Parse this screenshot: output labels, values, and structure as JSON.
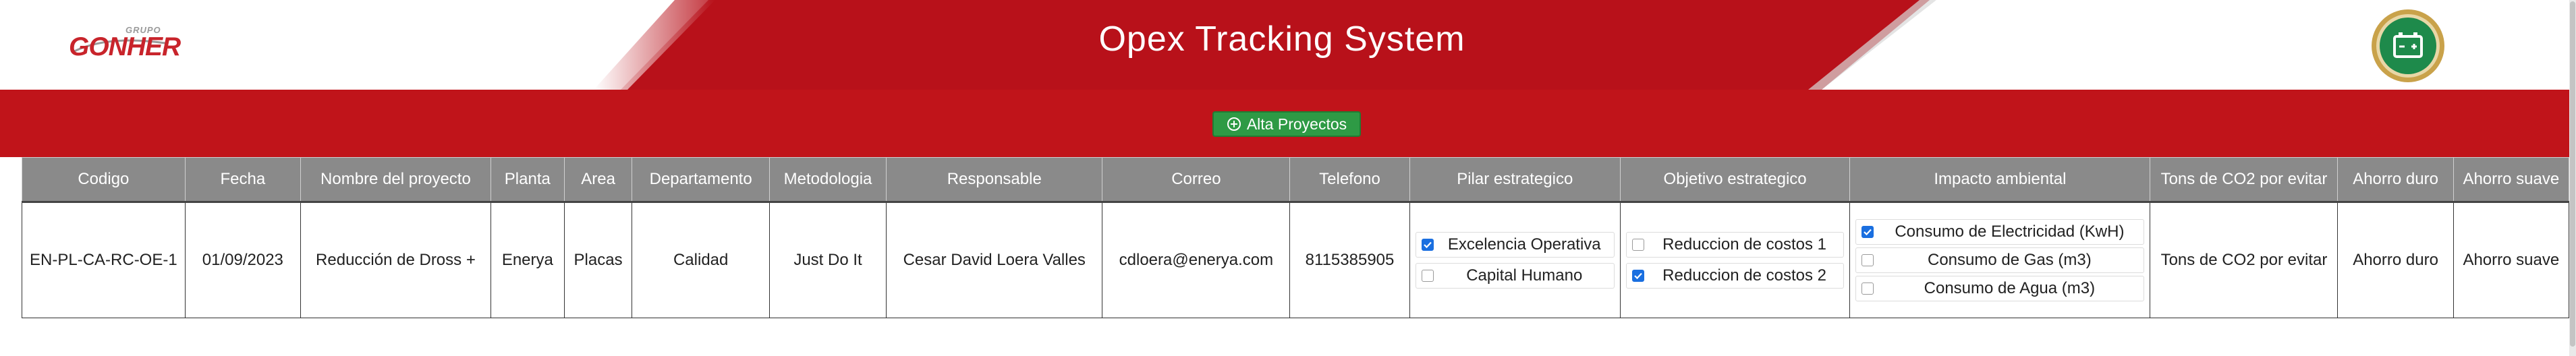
{
  "header": {
    "title": "Opex Tracking System",
    "logo": {
      "small": "GRUPO",
      "main": "GONHER"
    },
    "badge_icon": "battery-icon",
    "colors": {
      "brand_red": "#b8111a",
      "accent_green": "#2e9a45",
      "badge_gold": "#c9a24a"
    }
  },
  "toolbar": {
    "add_project_label": "Alta Proyectos",
    "add_project_icon": "plus-circle-icon"
  },
  "table": {
    "columns": [
      "Codigo",
      "Fecha",
      "Nombre del proyecto",
      "Planta",
      "Area",
      "Departamento",
      "Metodologia",
      "Responsable",
      "Correo",
      "Telefono",
      "Pilar estrategico",
      "Objetivo estrategico",
      "Impacto ambiental",
      "Tons de CO2 por evitar",
      "Ahorro duro",
      "Ahorro suave"
    ],
    "rows": [
      {
        "codigo": "EN-PL-CA-RC-OE-1",
        "fecha": "01/09/2023",
        "nombre": "Reducción de Dross +",
        "planta": "Enerya",
        "area": "Placas",
        "departamento": "Calidad",
        "metodologia": "Just Do It",
        "responsable": "Cesar David Loera Valles",
        "correo": "cdloera@enerya.com",
        "telefono": "8115385905",
        "pilar": [
          {
            "label": "Excelencia Operativa",
            "checked": true
          },
          {
            "label": "Capital Humano",
            "checked": false
          }
        ],
        "objetivo": [
          {
            "label": "Reduccion de costos 1",
            "checked": false
          },
          {
            "label": "Reduccion de costos 2",
            "checked": true
          }
        ],
        "impacto": [
          {
            "label": "Consumo de Electricidad (KwH)",
            "checked": true
          },
          {
            "label": "Consumo de Gas (m3)",
            "checked": false
          },
          {
            "label": "Consumo de Agua (m3)",
            "checked": false
          }
        ],
        "tons_co2": "Tons de CO2 por evitar",
        "ahorro_duro": "Ahorro duro",
        "ahorro_suave": "Ahorro suave"
      }
    ]
  }
}
